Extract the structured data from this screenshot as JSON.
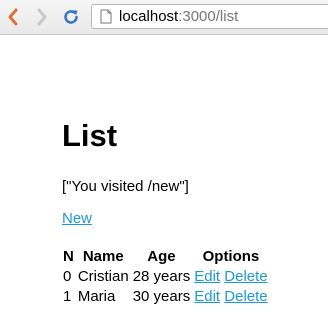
{
  "browser": {
    "url_host": "localhost",
    "url_rest": ":3000/list"
  },
  "page": {
    "title": "List",
    "flash": "[\"You visited /new\"]",
    "new_link": "New"
  },
  "table": {
    "headers": [
      "N",
      "Name",
      "Age",
      "Options"
    ],
    "rows": [
      {
        "n": "0",
        "name": "Cristian",
        "age": "28 years",
        "edit": "Edit",
        "delete": "Delete"
      },
      {
        "n": "1",
        "name": "Maria",
        "age": "30 years",
        "edit": "Edit",
        "delete": "Delete"
      }
    ]
  },
  "colors": {
    "link": "#1a9bd7",
    "back_arrow": "#e0703a",
    "reload": "#3b78c8"
  }
}
